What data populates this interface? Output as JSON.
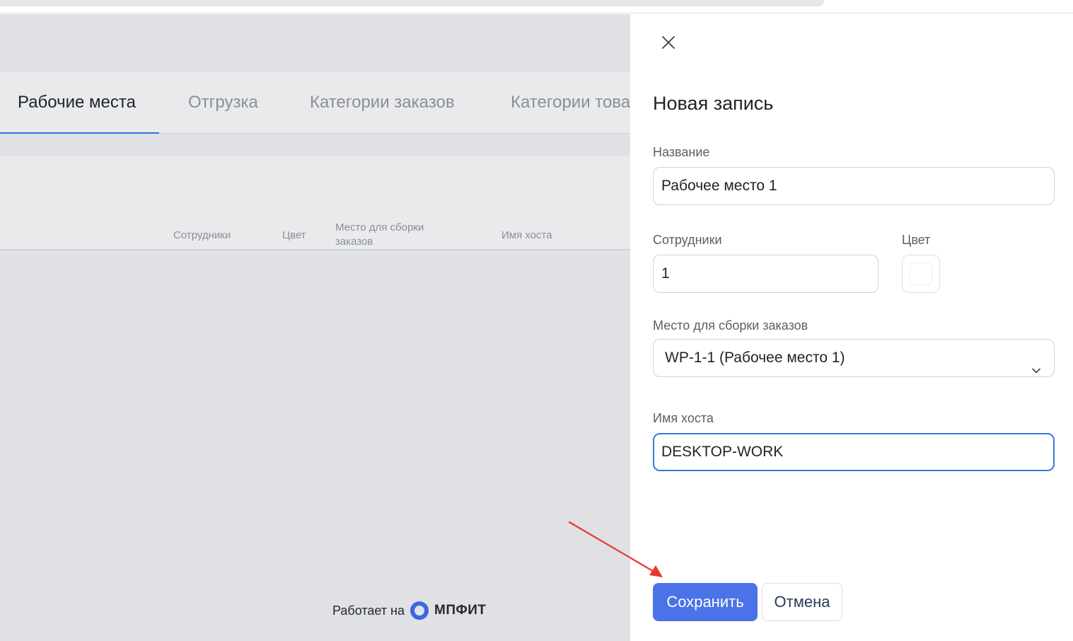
{
  "background": {
    "tabs": [
      {
        "label": "Рабочие места",
        "active": true
      },
      {
        "label": "Отгрузка",
        "active": false
      },
      {
        "label": "Категории заказов",
        "active": false
      },
      {
        "label": "Категории това",
        "active": false
      }
    ],
    "table_columns": [
      "Сотрудники",
      "Цвет",
      "Место для сборки заказов",
      "Имя хоста"
    ],
    "footer": {
      "prefix": "Работает на",
      "brand": "МПФИТ"
    }
  },
  "panel": {
    "title": "Новая запись",
    "name": {
      "label": "Название",
      "value": "Рабочее место 1"
    },
    "staff": {
      "label": "Сотрудники",
      "value": "1"
    },
    "color": {
      "label": "Цвет",
      "value": "#ffffff"
    },
    "place": {
      "label": "Место для сборки заказов",
      "selected": "WP-1-1 (Рабочее место 1)"
    },
    "host": {
      "label": "Имя хоста",
      "value": "DESKTOP-WORK"
    },
    "save_label": "Сохранить",
    "cancel_label": "Отмена"
  },
  "colors": {
    "primary": "#4a73e8",
    "focus_border": "#3a78d6",
    "annotation_arrow": "#e8382f"
  },
  "icons": {
    "close": "close-icon",
    "dropdown": "chevron-down-icon",
    "brand_logo": "mpfit-logo-icon"
  }
}
